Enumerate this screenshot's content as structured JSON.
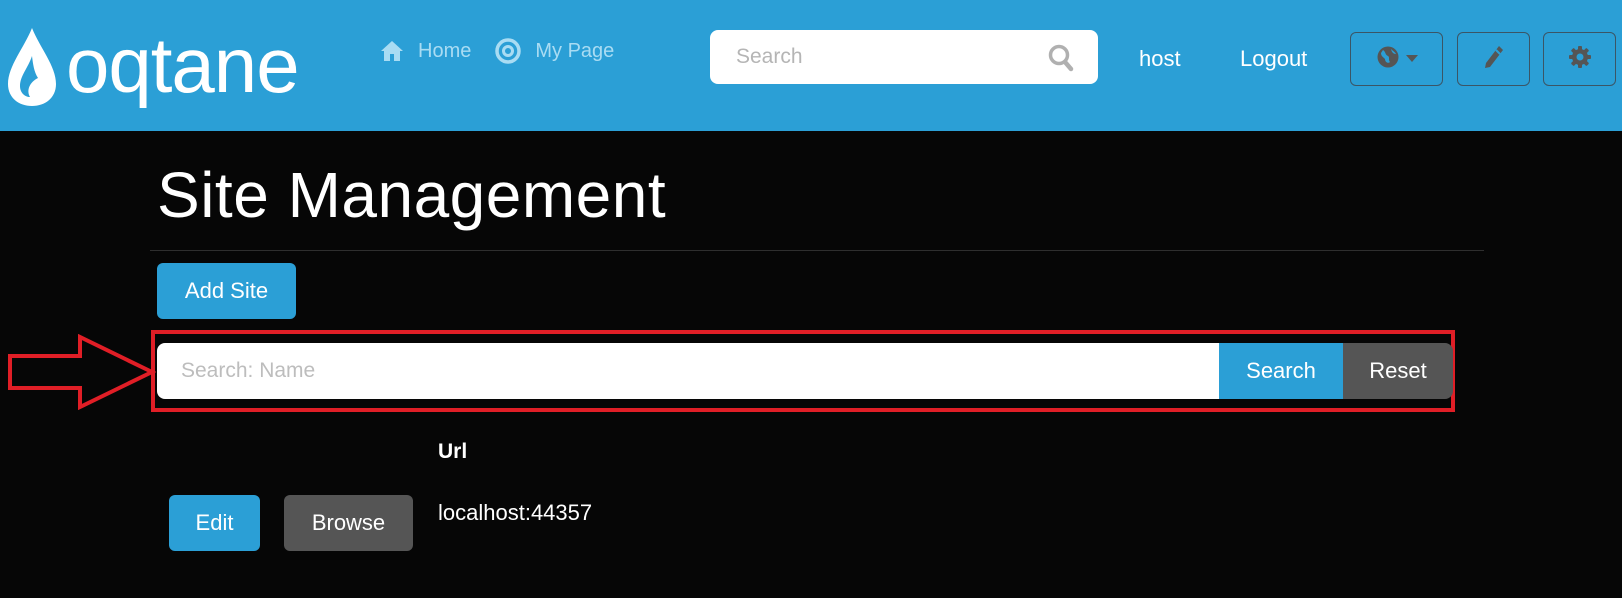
{
  "header": {
    "logo_text": "oqtane",
    "nav": [
      {
        "label": "Home",
        "icon": "home-icon"
      },
      {
        "label": "My Page",
        "icon": "target-icon"
      }
    ],
    "search": {
      "placeholder": "Search",
      "value": ""
    },
    "user_label": "host",
    "logout_label": "Logout",
    "tools": [
      {
        "icon": "globe-icon",
        "has_dropdown": true
      },
      {
        "icon": "pencil-icon"
      },
      {
        "icon": "gear-icon"
      }
    ],
    "colors": {
      "bar": "#2b9fd6",
      "nav_text": "#a9dcf3"
    }
  },
  "page": {
    "title": "Site Management",
    "add_button_label": "Add Site",
    "filter": {
      "placeholder": "Search: Name",
      "value": "",
      "search_button_label": "Search",
      "reset_button_label": "Reset"
    },
    "table": {
      "columns": [
        "",
        "",
        "Url"
      ],
      "rows": [
        {
          "edit_label": "Edit",
          "browse_label": "Browse",
          "url": "localhost:44357"
        }
      ]
    }
  },
  "annotation": {
    "highlight_color": "#e01e26"
  }
}
